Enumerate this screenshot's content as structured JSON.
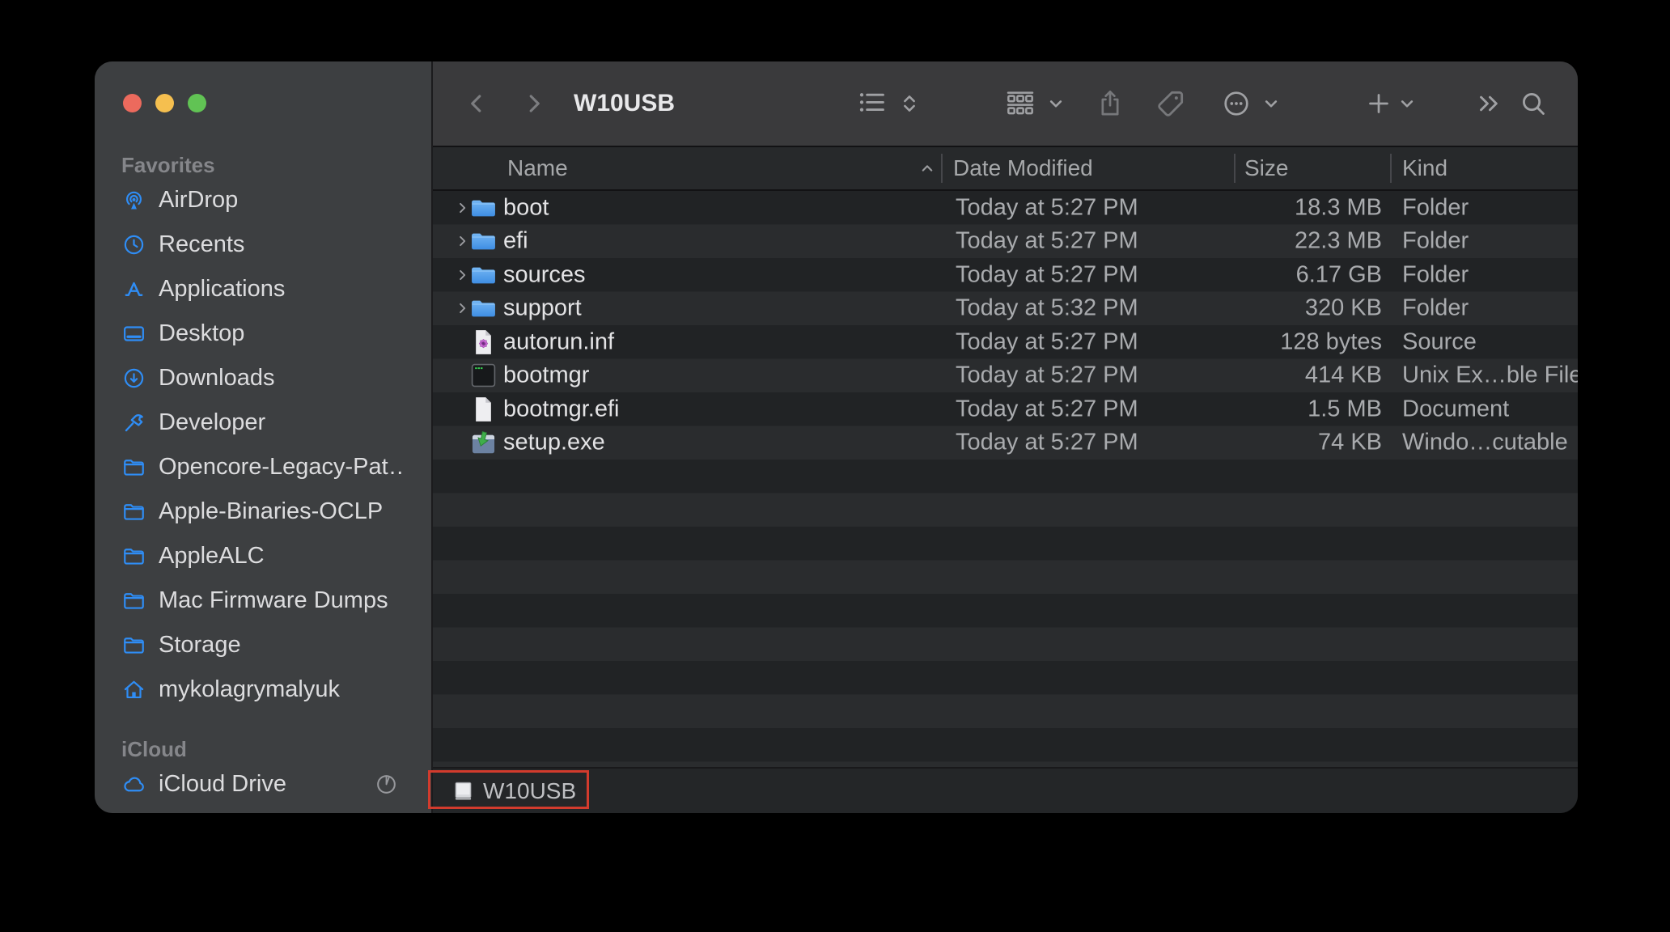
{
  "window": {
    "title": "W10USB"
  },
  "window_controls": {
    "colors": {
      "close": "#ec6a5d",
      "minimize": "#f5bf4f",
      "zoom": "#61c354"
    }
  },
  "toolbar": {
    "nav_icons": [
      "back-icon",
      "forward-icon"
    ],
    "icons": [
      "view-list-icon",
      "chevron-up-down-icon",
      "group-grid-icon",
      "chevron-down-icon",
      "share-icon",
      "tag-icon",
      "more-circle-icon",
      "chevron-down-icon",
      "plus-icon",
      "chevron-down-icon",
      "double-chevron-icon",
      "search-icon"
    ]
  },
  "sidebar": {
    "sections": [
      {
        "label": "Favorites",
        "items": [
          {
            "label": "AirDrop",
            "icon": "airdrop-icon"
          },
          {
            "label": "Recents",
            "icon": "clock-icon"
          },
          {
            "label": "Applications",
            "icon": "appstore-icon"
          },
          {
            "label": "Desktop",
            "icon": "desktop-icon"
          },
          {
            "label": "Downloads",
            "icon": "download-circle-icon"
          },
          {
            "label": "Developer",
            "icon": "hammer-icon"
          },
          {
            "label": "Opencore-Legacy-Pat…",
            "icon": "folder-outline-icon"
          },
          {
            "label": "Apple-Binaries-OCLP",
            "icon": "folder-outline-icon"
          },
          {
            "label": "AppleALC",
            "icon": "folder-outline-icon"
          },
          {
            "label": "Mac Firmware Dumps",
            "icon": "folder-outline-icon"
          },
          {
            "label": "Storage",
            "icon": "folder-outline-icon"
          },
          {
            "label": "mykolagrymalyuk",
            "icon": "home-icon"
          }
        ]
      },
      {
        "label": "iCloud",
        "items": [
          {
            "label": "iCloud Drive",
            "icon": "cloud-icon",
            "trailing_icon": "sync-progress-icon"
          }
        ]
      }
    ]
  },
  "file_list": {
    "columns": [
      {
        "label": "Name",
        "sort": "asc"
      },
      {
        "label": "Date Modified"
      },
      {
        "label": "Size"
      },
      {
        "label": "Kind"
      }
    ],
    "rows": [
      {
        "name": "boot",
        "date": "Today at 5:27 PM",
        "size": "18.3 MB",
        "kind": "Folder",
        "icon": "folder-icon",
        "expandable": true
      },
      {
        "name": "efi",
        "date": "Today at 5:27 PM",
        "size": "22.3 MB",
        "kind": "Folder",
        "icon": "folder-icon",
        "expandable": true
      },
      {
        "name": "sources",
        "date": "Today at 5:27 PM",
        "size": "6.17 GB",
        "kind": "Folder",
        "icon": "folder-icon",
        "expandable": true
      },
      {
        "name": "support",
        "date": "Today at 5:32 PM",
        "size": "320 KB",
        "kind": "Folder",
        "icon": "folder-icon",
        "expandable": true
      },
      {
        "name": "autorun.inf",
        "date": "Today at 5:27 PM",
        "size": "128 bytes",
        "kind": "Source",
        "icon": "setup-info-file-icon",
        "expandable": false
      },
      {
        "name": "bootmgr",
        "date": "Today at 5:27 PM",
        "size": "414 KB",
        "kind": "Unix Ex…ble File",
        "kind_full_hint": "Unix Ex...ble File",
        "icon": "unix-executable-icon",
        "expandable": false
      },
      {
        "name": "bootmgr.efi",
        "date": "Today at 5:27 PM",
        "size": "1.5 MB",
        "kind": "Document",
        "icon": "document-icon",
        "expandable": false
      },
      {
        "name": "setup.exe",
        "date": "Today at 5:27 PM",
        "size": "74 KB",
        "kind": "Windo…cutable",
        "icon": "windows-executable-icon",
        "expandable": false
      }
    ]
  },
  "path_bar": {
    "volume_label": "W10USB",
    "volume_icon": "disk-icon",
    "highlight_color": "#d23b2d"
  },
  "colors": {
    "accent_blue": "#2f8df5",
    "sidebar_bg": "#3d3f41",
    "toolbar_bg": "#3a3a3c",
    "row_dark": "#212325",
    "row_light": "#2a2c2e"
  }
}
